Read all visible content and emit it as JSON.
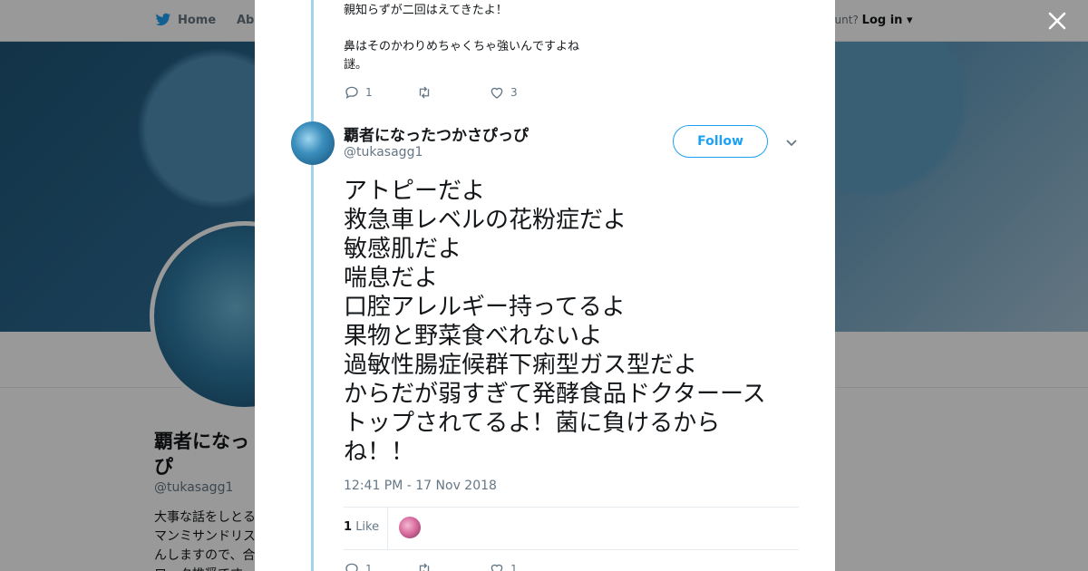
{
  "background": {
    "nav": {
      "home_label": "Home",
      "about_label": "Abo",
      "account_prompt": "ccount?",
      "login_label": "Log in"
    },
    "profile": {
      "name": "覇者になっ ぴ",
      "handle": "@tukasagg1",
      "bio": "大事な話をしとる マンミサンドリス んしますので、合 ロック推奨です"
    }
  },
  "modal": {
    "previous_tweet": {
      "lines": [
        "親知らずが二回はえてきたよ！",
        "",
        "鼻はそのかわりめちゃくちゃ強いんですよね",
        "謎。"
      ],
      "reply_count": "1",
      "retweet_count": "",
      "like_count": "3"
    },
    "tweet": {
      "display_name": "覇者になったつかさぴっぴ",
      "handle": "@tukasagg1",
      "follow_label": "Follow",
      "text_lines": [
        "アトピーだよ",
        "救急車レベルの花粉症だよ",
        "敏感肌だよ",
        "喘息だよ",
        "口腔アレルギー持ってるよ",
        "果物と野菜食べれないよ",
        "過敏性腸症候群下痢型ガス型だよ",
        "からだが弱すぎて発酵食品ドクターース",
        "トップされてるよ！菌に負けるから",
        "ね！！"
      ],
      "timestamp": "12:41 PM - 17 Nov 2018",
      "likes_count": "1",
      "likes_label": "Like",
      "reply_count": "1",
      "retweet_count": "",
      "like_count": "1"
    }
  },
  "colors": {
    "accent": "#1da1f2",
    "thread_line": "#a2d2ee",
    "text_muted": "#657786"
  }
}
